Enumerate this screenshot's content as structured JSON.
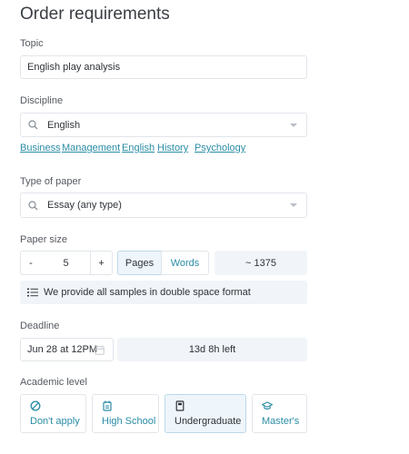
{
  "page": {
    "title": "Order requirements"
  },
  "topic": {
    "label": "Topic",
    "value": "English play analysis"
  },
  "discipline": {
    "label": "Discipline",
    "value": "English",
    "suggestions": [
      "Business",
      "Management",
      "English",
      "History",
      "Psychology"
    ]
  },
  "paper_type": {
    "label": "Type of paper",
    "value": "Essay (any type)"
  },
  "paper_size": {
    "label": "Paper size",
    "minus": "-",
    "count": "5",
    "plus": "+",
    "units": [
      "Pages",
      "Words"
    ],
    "selected_unit": "Pages",
    "word_estimate": "~ 1375",
    "note": "We provide all samples in double space format"
  },
  "deadline": {
    "label": "Deadline",
    "date": "Jun 28 at 12PM",
    "time_left": "13d 8h left"
  },
  "academic_level": {
    "label": "Academic level",
    "options": [
      {
        "label": "Don't apply",
        "icon": "ban-icon"
      },
      {
        "label": "High School",
        "icon": "school-icon"
      },
      {
        "label": "Undergraduate",
        "icon": "book-icon"
      },
      {
        "label": "Master's",
        "icon": "graduation-cap-icon"
      }
    ],
    "selected": "Undergraduate"
  },
  "colors": {
    "accent": "#2a8da5",
    "shaded": "#f1f5f9",
    "border": "#e1e5ea",
    "selected_bg": "#eef5fb"
  }
}
